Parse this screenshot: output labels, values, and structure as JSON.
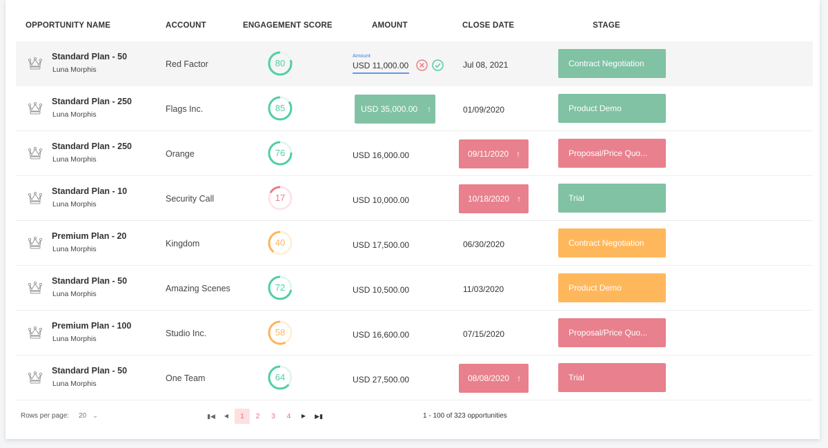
{
  "columns": [
    "OPPORTUNITY NAME",
    "ACCOUNT",
    "ENGAGEMENT SCORE",
    "AMOUNT",
    "CLOSE DATE",
    "STAGE"
  ],
  "colors": {
    "green": "#80c2a3",
    "red": "#e8808d",
    "orange": "#ffb75c",
    "ring_green": "#4fcfa0",
    "ring_red": "#f07a85",
    "ring_orange": "#ffb45a"
  },
  "edit": {
    "label": "Amount",
    "value": "USD 11,000.00"
  },
  "rows": [
    {
      "name": "Standard Plan - 50",
      "owner": "Luna Morphis",
      "account": "Red Factor",
      "score": 80,
      "score_color": "green",
      "amount": "USD 11,000.00",
      "amount_state": "editing",
      "date": "Jul 08, 2021",
      "date_state": "",
      "stage": "Contract Negotiation",
      "stage_color": "green"
    },
    {
      "name": "Standard Plan - 250",
      "owner": "Luna Morphis",
      "account": "Flags Inc.",
      "score": 85,
      "score_color": "green",
      "amount": "USD 35,000.00",
      "amount_state": "up",
      "date": "01/09/2020",
      "date_state": "",
      "stage": "Product Demo",
      "stage_color": "green"
    },
    {
      "name": "Standard Plan - 250",
      "owner": "Luna Morphis",
      "account": "Orange",
      "score": 76,
      "score_color": "green",
      "amount": "USD 16,000.00",
      "amount_state": "",
      "date": "09/11/2020",
      "date_state": "up",
      "stage": "Proposal/Price Quo...",
      "stage_color": "red"
    },
    {
      "name": "Standard Plan - 10",
      "owner": "Luna Morphis",
      "account": "Security Call",
      "score": 17,
      "score_color": "red",
      "amount": "USD 10,000.00",
      "amount_state": "",
      "date": "10/18/2020",
      "date_state": "up",
      "stage": "Trial",
      "stage_color": "green"
    },
    {
      "name": "Premium Plan - 20",
      "owner": "Luna Morphis",
      "account": "Kingdom",
      "score": 40,
      "score_color": "orange",
      "amount": "USD 17,500.00",
      "amount_state": "",
      "date": "06/30/2020",
      "date_state": "",
      "stage": "Contract Negotiation",
      "stage_color": "orange"
    },
    {
      "name": "Standard Plan - 50",
      "owner": "Luna Morphis",
      "account": "Amazing Scenes",
      "score": 72,
      "score_color": "green",
      "amount": "USD 10,500.00",
      "amount_state": "",
      "date": "11/03/2020",
      "date_state": "",
      "stage": "Product Demo",
      "stage_color": "orange"
    },
    {
      "name": "Premium Plan - 100",
      "owner": "Luna Morphis",
      "account": "Studio Inc.",
      "score": 58,
      "score_color": "orange",
      "amount": "USD 16,600.00",
      "amount_state": "",
      "date": "07/15/2020",
      "date_state": "",
      "stage": "Proposal/Price Quo...",
      "stage_color": "red"
    },
    {
      "name": "Standard Plan - 50",
      "owner": "Luna Morphis",
      "account": "One Team",
      "score": 64,
      "score_color": "green",
      "amount": "USD  27,500.00",
      "amount_state": "",
      "date": "08/08/2020",
      "date_state": "up",
      "stage": "Trial",
      "stage_color": "red"
    }
  ],
  "footer": {
    "rows_per_page_label": "Rows per page:",
    "rows_per_page": "20",
    "pages": [
      "1",
      "2",
      "3",
      "4"
    ],
    "current_page": "1",
    "summary": "1 - 100 of 323 opportunities"
  }
}
